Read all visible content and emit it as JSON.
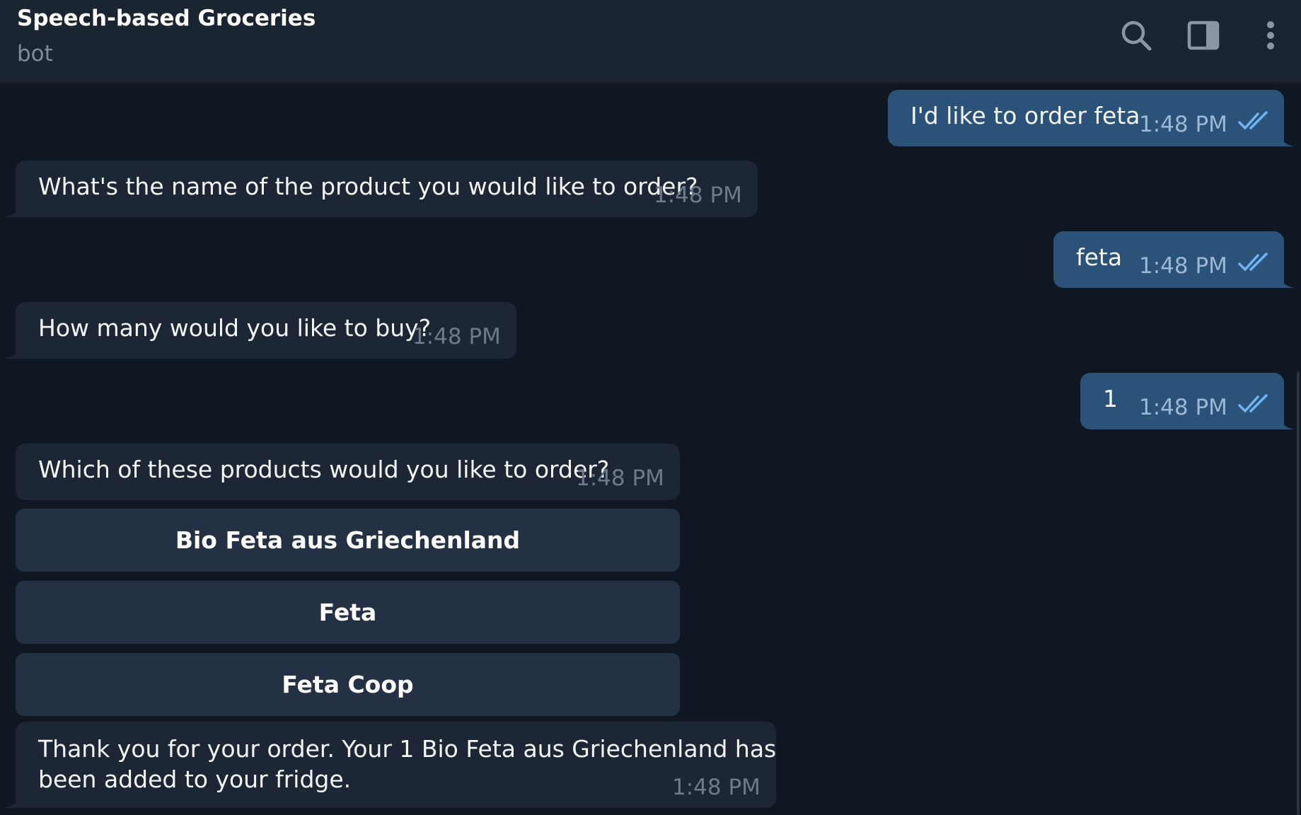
{
  "header": {
    "title": "Speech-based Groceries",
    "subtitle": "bot",
    "icons": [
      "search-icon",
      "sidebar-toggle-icon",
      "more-vertical-icon"
    ]
  },
  "colors": {
    "background": "#0f1722",
    "header": "#1b2431",
    "incoming_bubble": "#1d2634",
    "outgoing_bubble": "#2b5278",
    "keyboard_button": "#243044",
    "read_check": "#6fb3f2"
  },
  "messages": [
    {
      "direction": "out",
      "text": "I'd like to order feta",
      "time": "1:48 PM",
      "status": "read"
    },
    {
      "direction": "in",
      "text": "What's the name of the product you would like to order?",
      "time": "1:48 PM"
    },
    {
      "direction": "out",
      "text": "feta",
      "time": "1:48 PM",
      "status": "read"
    },
    {
      "direction": "in",
      "text": "How many would you like to buy?",
      "time": "1:48 PM"
    },
    {
      "direction": "out",
      "text": "1",
      "time": "1:48 PM",
      "status": "read"
    },
    {
      "direction": "in",
      "text": "Which of these products would you like to order?",
      "time": "1:48 PM"
    },
    {
      "direction": "in",
      "text_line1": "Thank you for your order. Your 1 Bio Feta aus Griechenland has",
      "text_line2": "been added to your fridge.",
      "time": "1:48 PM"
    }
  ],
  "keyboard": {
    "buttons": [
      "Bio Feta aus Griechenland",
      "Feta",
      "Feta Coop"
    ]
  }
}
